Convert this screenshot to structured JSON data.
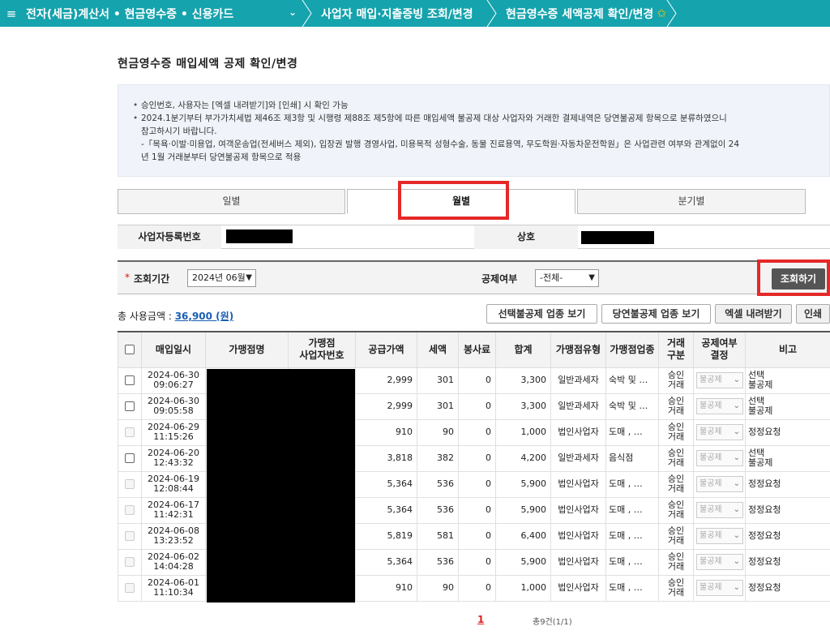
{
  "nav": {
    "menu_icon": "≡",
    "crumb1": "전자(세금)계산서 • 현금영수증 • 신용카드",
    "dropdown_icon": "⌄",
    "crumb2": "사업자 매입·지출증빙 조회/변경",
    "crumb3": "현금영수증 세액공제 확인/변경",
    "star": "✩"
  },
  "page_title": "현금영수증 매입세액 공제 확인/변경",
  "notice": {
    "line1": "승인번호, 사용자는 [엑셀 내려받기]와 [인쇄] 시 확인 가능",
    "line2": "2024.1분기부터 부가가치세법 제46조 제3항 및 시행령 제88조 제5항에 따른 매입세액 불공제 대상 사업자와 거래한 결제내역은 당연불공제 항목으로 분류하였으니",
    "line3": "참고하시기 바랍니다.",
    "line4": "-「목욕·이발·미용업, 여객운송업(전세버스 제외), 입장권 발행 경영사업, 미용목적 성형수술, 동물 진료용역, 무도학원·자동차운전학원」은 사업관련 여부와 관계없이 24",
    "line5": "년 1월 거래분부터 당연불공제 항목으로 적용"
  },
  "tabs": [
    "일별",
    "월별",
    "분기별"
  ],
  "info": {
    "bizno_label": "사업자등록번호",
    "name_label": "상호"
  },
  "search": {
    "req_mark": "*",
    "period_label": "조회기간",
    "period_value": "2024년 06월",
    "deduct_label": "공제여부",
    "deduct_value": "-전체-",
    "search_button": "조회하기"
  },
  "summary": {
    "total_label": "총 사용금액 : ",
    "total_value": "36,900 (원)"
  },
  "actions": {
    "optional_view": "선택불공제 업종 보기",
    "automatic_view": "당연불공제 업종 보기",
    "excel": "엑셀 내려받기",
    "print": "인쇄"
  },
  "table": {
    "headers": [
      "매입일시",
      "가맹점명",
      "가맹점\n사업자번호",
      "공급가액",
      "세액",
      "봉사료",
      "합계",
      "가맹점유형",
      "가맹점업종",
      "거래\n구분",
      "공제여부\n결정",
      "비고"
    ],
    "rows": [
      {
        "date": "2024-06-30",
        "time": "09:06:27",
        "supply": "2,999",
        "tax": "301",
        "svc": "0",
        "total": "3,300",
        "type": "일반과세자",
        "industry": "숙박 및 …",
        "trade1": "승인",
        "trade2": "거래",
        "decision": "불공제",
        "note1": "선택",
        "note2": "불공제",
        "checkable": true
      },
      {
        "date": "2024-06-30",
        "time": "09:05:58",
        "supply": "2,999",
        "tax": "301",
        "svc": "0",
        "total": "3,300",
        "type": "일반과세자",
        "industry": "숙박 및 …",
        "trade1": "승인",
        "trade2": "거래",
        "decision": "불공제",
        "note1": "선택",
        "note2": "불공제",
        "checkable": true
      },
      {
        "date": "2024-06-29",
        "time": "11:15:26",
        "supply": "910",
        "tax": "90",
        "svc": "0",
        "total": "1,000",
        "type": "법인사업자",
        "industry": "도매 , …",
        "trade1": "승인",
        "trade2": "거래",
        "decision": "불공제",
        "note1": "정정요청",
        "note2": "",
        "checkable": false
      },
      {
        "date": "2024-06-20",
        "time": "12:43:32",
        "supply": "3,818",
        "tax": "382",
        "svc": "0",
        "total": "4,200",
        "type": "일반과세자",
        "industry": "음식점",
        "trade1": "승인",
        "trade2": "거래",
        "decision": "불공제",
        "note1": "선택",
        "note2": "불공제",
        "checkable": true
      },
      {
        "date": "2024-06-19",
        "time": "12:08:44",
        "supply": "5,364",
        "tax": "536",
        "svc": "0",
        "total": "5,900",
        "type": "법인사업자",
        "industry": "도매 , …",
        "trade1": "승인",
        "trade2": "거래",
        "decision": "불공제",
        "note1": "정정요청",
        "note2": "",
        "checkable": false
      },
      {
        "date": "2024-06-17",
        "time": "11:42:31",
        "supply": "5,364",
        "tax": "536",
        "svc": "0",
        "total": "5,900",
        "type": "법인사업자",
        "industry": "도매 , …",
        "trade1": "승인",
        "trade2": "거래",
        "decision": "불공제",
        "note1": "정정요청",
        "note2": "",
        "checkable": false
      },
      {
        "date": "2024-06-08",
        "time": "13:23:52",
        "supply": "5,819",
        "tax": "581",
        "svc": "0",
        "total": "6,400",
        "type": "법인사업자",
        "industry": "도매 , …",
        "trade1": "승인",
        "trade2": "거래",
        "decision": "불공제",
        "note1": "정정요청",
        "note2": "",
        "checkable": false
      },
      {
        "date": "2024-06-02",
        "time": "14:04:28",
        "supply": "5,364",
        "tax": "536",
        "svc": "0",
        "total": "5,900",
        "type": "법인사업자",
        "industry": "도매 , …",
        "trade1": "승인",
        "trade2": "거래",
        "decision": "불공제",
        "note1": "정정요청",
        "note2": "",
        "checkable": false
      },
      {
        "date": "2024-06-01",
        "time": "11:10:34",
        "supply": "910",
        "tax": "90",
        "svc": "0",
        "total": "1,000",
        "type": "법인사업자",
        "industry": "도매 , …",
        "trade1": "승인",
        "trade2": "거래",
        "decision": "불공제",
        "note1": "정정요청",
        "note2": "",
        "checkable": false
      }
    ]
  },
  "pager": {
    "current": "1",
    "info": "총9건(1/1)"
  },
  "colors": {
    "nav": "#15a3ad",
    "highlight": "#e52828",
    "link": "#1a5fb4"
  }
}
